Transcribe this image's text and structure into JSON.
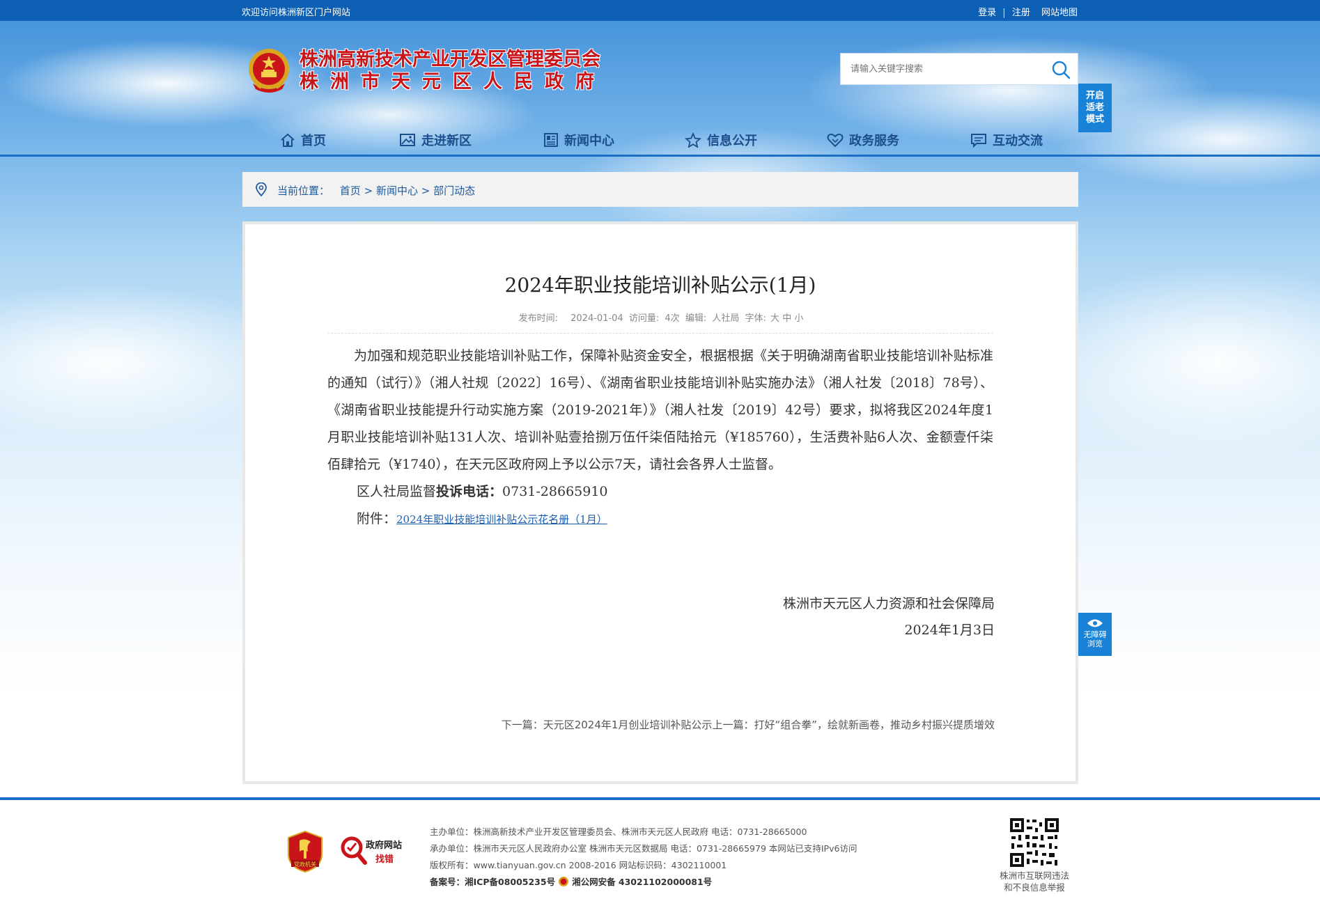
{
  "topbar": {
    "welcome": "欢迎访问株洲新区门户网站",
    "login": "登录",
    "separator": "|",
    "register": "注册",
    "sitemap": "网站地图"
  },
  "header": {
    "title_line1": "株洲高新技术产业开发区管理委员会",
    "title_line2": "株洲市天元区人民政府",
    "search_placeholder": "请输入关键字搜索",
    "elder_mode": [
      "开启",
      "适老",
      "模式"
    ]
  },
  "nav": {
    "items": [
      {
        "label": "首页",
        "icon": "home-icon"
      },
      {
        "label": "走进新区",
        "icon": "picture-icon"
      },
      {
        "label": "新闻中心",
        "icon": "news-icon"
      },
      {
        "label": "信息公开",
        "icon": "star-icon"
      },
      {
        "label": "政务服务",
        "icon": "heart-icon"
      },
      {
        "label": "互动交流",
        "icon": "chat-icon"
      }
    ]
  },
  "breadcrumb": {
    "prefix": "当前位置：",
    "home": "首页",
    "sep": ">",
    "level2": "新闻中心",
    "level3": "部门动态"
  },
  "article": {
    "title": "2024年职业技能培训补贴公示(1月)",
    "meta": {
      "date_label": "发布时间:",
      "date": "2024-01-04",
      "views_label": "访问量:",
      "views": "4次",
      "editor_label": "编辑:",
      "editor": "人社局",
      "font_label": "字体:",
      "font_large": "大",
      "font_medium": "中",
      "font_small": "小"
    },
    "paragraph1": "为加强和规范职业技能培训补贴工作，保障补贴资金安全，根据根据《关于明确湖南省职业技能培训补贴标准的通知（试行）》（湘人社规〔2022〕16号）、《湖南省职业技能培训补贴实施办法》（湘人社发〔2018〕78号）、《湖南省职业技能提升行动实施方案（2019-2021年）》（湘人社发〔2019〕42号）要求，拟将我区2024年度1月职业技能培训补贴131人次、培训补贴壹拾捌万伍仟柒佰陆拾元（¥185760），生活费补贴6人次、金额壹仟柒佰肆拾元（¥1740），在天元区政府网上予以公示7天，请社会各界人士监督。",
    "hotline_prefix": "区人社局监督",
    "hotline_label": "投诉电话：",
    "hotline_number": "0731-28665910",
    "attachment_label": "附件：",
    "attachment_link": "2024年职业技能培训补贴公示花名册（1月）",
    "signer": "株洲市天元区人力资源和社会保障局",
    "sign_date": "2024年1月3日",
    "next_label": "下一篇：",
    "next_title": "天元区2024年1月创业培训补贴公示",
    "prev_label": "上一篇：",
    "prev_title": "打好“组合拳”，绘就新画卷，推动乡村振兴提质增效"
  },
  "float": {
    "a11y_line1": "无障碍",
    "a11y_line2": "浏览"
  },
  "footer": {
    "badge1_text": "党政机关",
    "badge2_top": "政府网站",
    "badge2_bottom": "找错",
    "line1": "主办单位：株洲高新技术产业开发区管理委员会、株洲市天元区人民政府 电话：0731-28665000",
    "line2": "承办单位：株洲市天元区人民政府办公室 株洲市天元区数据局 电话：0731-28665979 本网站已支持IPv6访问",
    "line3": "版权所有：www.tianyuan.gov.cn 2008-2016 网站标识码：4302110001",
    "record_label": "备案号：",
    "icp": "湘ICP备08005235号",
    "police": "湘公网安备 43021102000081号",
    "qr_caption_1": "株洲市互联网违法",
    "qr_caption_2": "和不良信息举报"
  },
  "colors": {
    "topbar": "#0d5fb3",
    "nav_text": "#1b4e8c",
    "title_red": "#c9141a",
    "accent_blue": "#1a82d6"
  }
}
